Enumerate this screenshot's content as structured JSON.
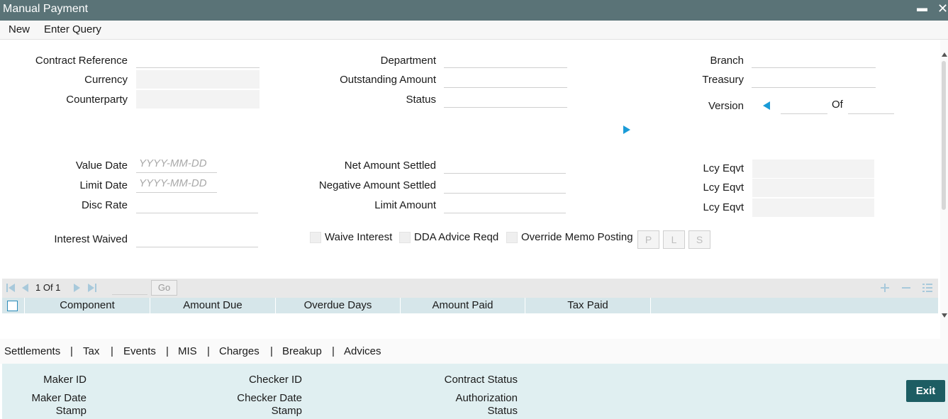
{
  "window": {
    "title": "Manual Payment",
    "minimize_glyph": "▬",
    "close_glyph": "✕"
  },
  "menu": {
    "new_label": "New",
    "enter_query_label": "Enter Query"
  },
  "header_fields": {
    "contract_reference": "Contract Reference",
    "currency": "Currency",
    "counterparty": "Counterparty",
    "department": "Department",
    "outstanding_amount": "Outstanding Amount",
    "status": "Status",
    "branch": "Branch",
    "treasury": "Treasury",
    "version": "Version",
    "of": "Of"
  },
  "details": {
    "value_date": "Value Date",
    "limit_date": "Limit Date",
    "disc_rate": "Disc Rate",
    "interest_waived": "Interest Waived",
    "date_placeholder": "YYYY-MM-DD",
    "net_amount_settled": "Net Amount Settled",
    "negative_amount_settled": "Negative Amount Settled",
    "limit_amount": "Limit Amount",
    "lcy_eqvt": "Lcy Eqvt",
    "waive_interest": "Waive Interest",
    "dda_advice_reqd": "DDA Advice Reqd",
    "override_memo_posting": "Override Memo Posting",
    "btn_p": "P",
    "btn_l": "L",
    "btn_s": "S"
  },
  "grid": {
    "page_text": "1 Of 1",
    "go_label": "Go",
    "columns": [
      "Component",
      "Amount Due",
      "Overdue Days",
      "Amount Paid",
      "Tax Paid"
    ]
  },
  "tabs": [
    "Settlements",
    "Tax",
    "Events",
    "MIS",
    "Charges",
    "Breakup",
    "Advices"
  ],
  "tab_separator": "|",
  "footer": {
    "maker_id": "Maker ID",
    "maker_date_l1": "Maker Date",
    "maker_date_l2": "Stamp",
    "checker_id": "Checker ID",
    "checker_date_l1": "Checker Date",
    "checker_date_l2": "Stamp",
    "contract_status": "Contract Status",
    "auth_status_l1": "Authorization",
    "auth_status_l2": "Status"
  },
  "exit_label": "Exit",
  "colors": {
    "titlebar": "#5a7377",
    "accent_arrow": "#1a9bd7",
    "exit_button": "#1d5d63",
    "footer_bg": "#e0eff1",
    "grid_header": "#d6e6ea"
  }
}
